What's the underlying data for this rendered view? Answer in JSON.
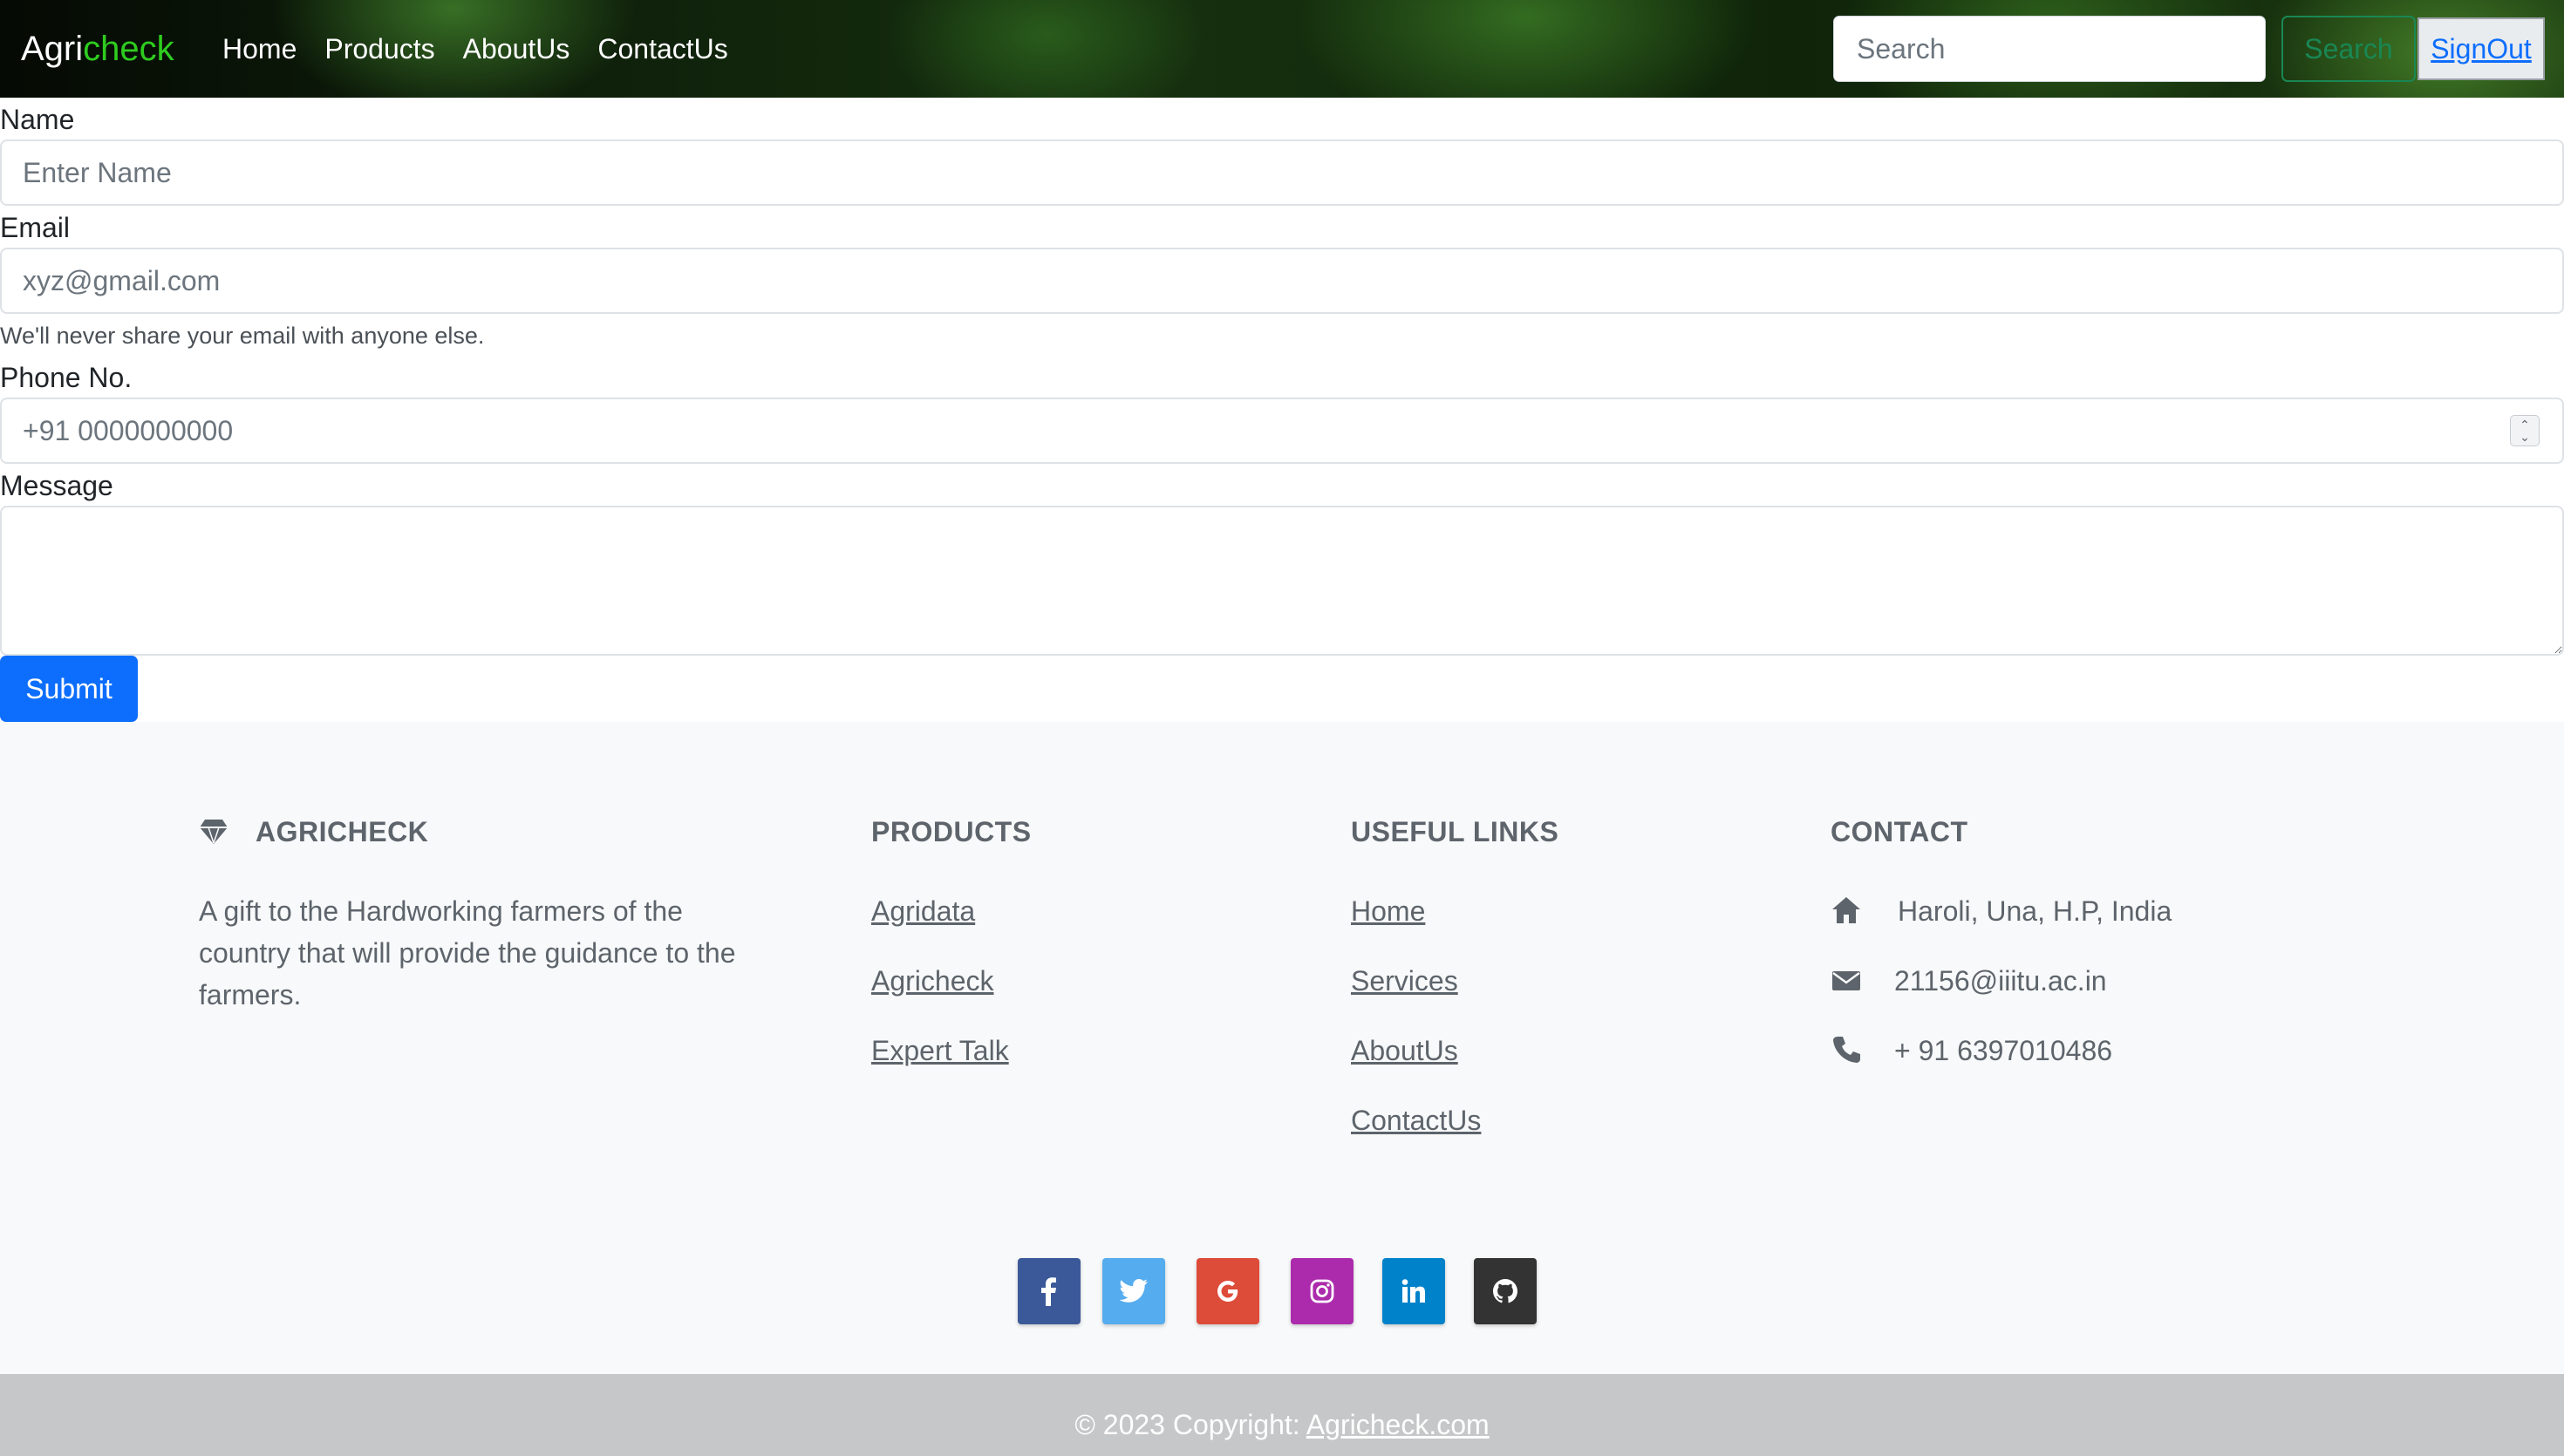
{
  "navbar": {
    "brand_part1": "Agri",
    "brand_part2": "check",
    "brand_accent_color": "#2ecc1f",
    "links": [
      "Home",
      "Products",
      "AboutUs",
      "ContactUs"
    ],
    "search_placeholder": "Search",
    "search_button": "Search",
    "signout": "SignOut"
  },
  "form": {
    "name_label": "Name",
    "name_placeholder": "Enter Name",
    "email_label": "Email",
    "email_placeholder": "xyz@gmail.com",
    "email_help": "We'll never share your email with anyone else.",
    "phone_label": "Phone No.",
    "phone_placeholder": "+91 0000000000",
    "message_label": "Message",
    "submit": "Submit",
    "submit_color": "#0d6efd"
  },
  "footer": {
    "brand_icon": "gem-icon",
    "brand_heading": "AGRICHECK",
    "brand_description": "A gift to the Hardworking farmers of the country that will provide the guidance to the farmers.",
    "products_heading": "PRODUCTS",
    "products": [
      "Agridata",
      "Agricheck",
      "Expert Talk"
    ],
    "links_heading": "USEFUL LINKS",
    "links": [
      "Home",
      "Services",
      "AboutUs",
      "ContactUs"
    ],
    "contact_heading": "CONTACT",
    "contact": [
      {
        "icon": "home-icon",
        "text": "Haroli, Una, H.P, India"
      },
      {
        "icon": "envelope-icon",
        "text": "21156@iiitu.ac.in"
      },
      {
        "icon": "phone-icon",
        "text": "+ 91 6397010486"
      }
    ],
    "socials": [
      {
        "icon": "facebook-icon",
        "color": "#3b5998"
      },
      {
        "icon": "twitter-icon",
        "color": "#55acee"
      },
      {
        "icon": "google-icon",
        "color": "#dd4b39"
      },
      {
        "icon": "instagram-icon",
        "color": "#ac2bac"
      },
      {
        "icon": "linkedin-icon",
        "color": "#0082ca"
      },
      {
        "icon": "github-icon",
        "color": "#333333"
      }
    ],
    "copyright_prefix": "© 2023 Copyright: ",
    "copyright_link": "Agricheck.com"
  }
}
